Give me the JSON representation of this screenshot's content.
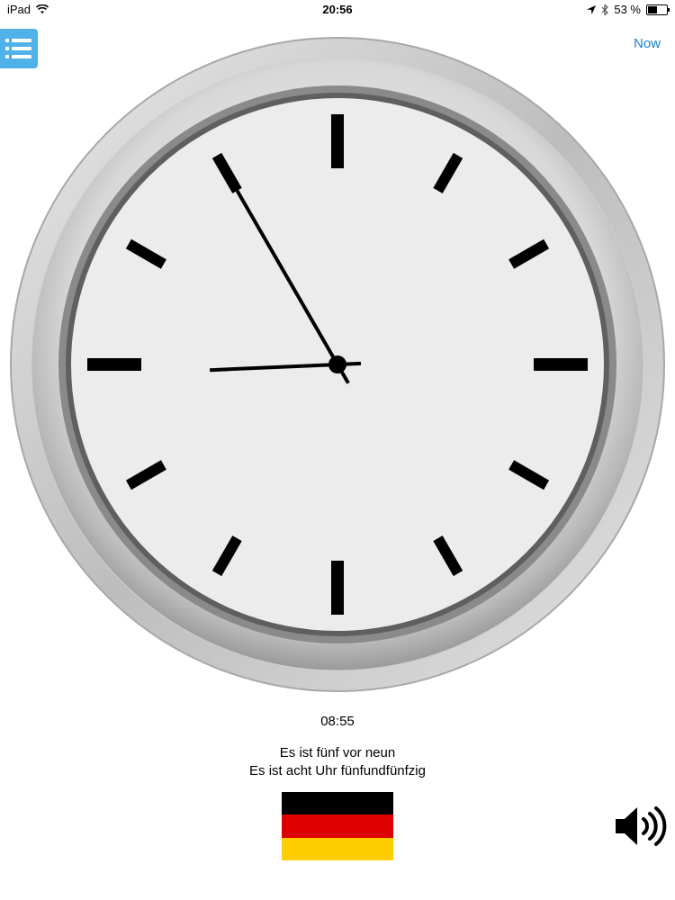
{
  "status_bar": {
    "device": "iPad",
    "time": "20:56",
    "battery": "53 %",
    "battery_level": 0.53,
    "icons": [
      "wifi-icon",
      "location-arrow-icon",
      "bluetooth-icon",
      "battery-icon"
    ]
  },
  "toolbar": {
    "menu_icon": "list-icon",
    "now_label": "Now"
  },
  "clock": {
    "hours": 8,
    "minutes": 55,
    "face_color": "#ececec",
    "bezel_color": "#c9c9c9"
  },
  "time_display": {
    "digital": "08:55",
    "phrase_1": "Es ist fünf vor neun",
    "phrase_2": "Es ist acht Uhr fünfundfünfzig"
  },
  "language": {
    "flag": "germany-flag",
    "flag_colors": [
      "#000000",
      "#dd0000",
      "#ffce00"
    ]
  },
  "audio": {
    "icon": "speaker-icon"
  }
}
